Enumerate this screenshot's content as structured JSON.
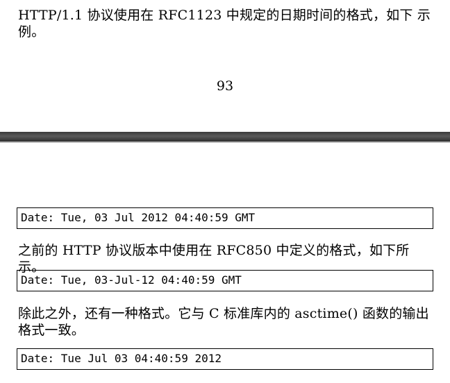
{
  "page_top": {
    "paragraph": "HTTP/1.1 协议使用在 RFC1123 中规定的日期时间的格式，如下 示例。",
    "page_number": "93"
  },
  "page_body": {
    "code_1": "Date: Tue, 03 Jul 2012 04:40:59 GMT",
    "paragraph_1": "之前的 HTTP 协议版本中使用在 RFC850 中定义的格式，如下所示。",
    "code_2": "Date: Tue, 03-Jul-12 04:40:59 GMT",
    "paragraph_2": "除此之外，还有一种格式。它与 C 标准库内的 asctime() 函数的输出格式一致。",
    "code_3": "Date: Tue Jul 03 04:40:59 2012"
  }
}
